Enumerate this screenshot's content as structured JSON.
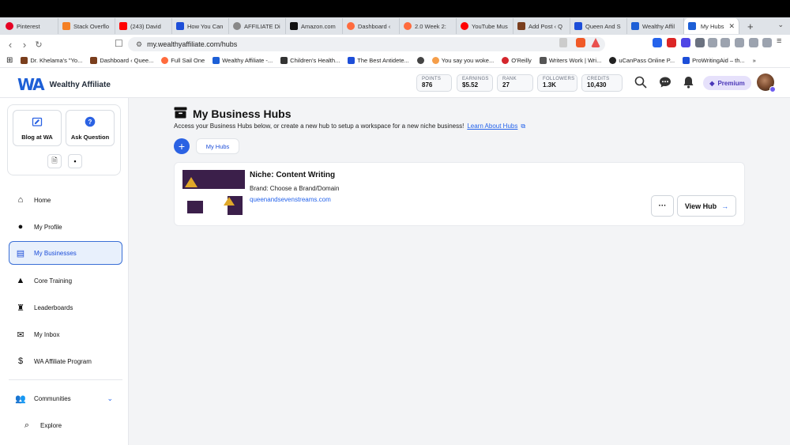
{
  "browser": {
    "tabs": [
      {
        "title": "Pinterest",
        "color": "#e60023"
      },
      {
        "title": "Stack Overflo",
        "color": "#f48024"
      },
      {
        "title": "(243) David",
        "color": "#ff0000"
      },
      {
        "title": "How You Can",
        "color": "#1d4ed8"
      },
      {
        "title": "AFFILIATE Di",
        "color": "#888888"
      },
      {
        "title": "Amazon.com",
        "color": "#111111"
      },
      {
        "title": "Dashboard ‹",
        "color": "#ff6b3d"
      },
      {
        "title": "2.0 Week 2:",
        "color": "#ff6b3d"
      },
      {
        "title": "YouTube Mus",
        "color": "#ff0000"
      },
      {
        "title": "Add Post ‹ Q",
        "color": "#7a3e1d"
      },
      {
        "title": "Queen And S",
        "color": "#1d4ed8"
      },
      {
        "title": "Wealthy Affil",
        "color": "#1d5fd6"
      }
    ],
    "active_tab": {
      "title": "My Hubs",
      "color": "#1d5fd6"
    },
    "url": "my.wealthyaffiliate.com/hubs",
    "bookmarks": [
      {
        "title": "Dr. Khelama's \"Yo...",
        "color": "#7a3e1d"
      },
      {
        "title": "Dashboard ‹ Quee...",
        "color": "#7a3e1d"
      },
      {
        "title": "Full Sail One",
        "color": "#ff6b3d"
      },
      {
        "title": "Wealthy Affiliate -...",
        "color": "#1d5fd6"
      },
      {
        "title": "Children's Health...",
        "color": "#333333"
      },
      {
        "title": "The Best Antidete...",
        "color": "#1d4ed8"
      },
      {
        "title": "",
        "color": "#444444"
      },
      {
        "title": "You say you woke...",
        "color": "#f59e4a"
      },
      {
        "title": "O'Reilly",
        "color": "#d4262c"
      },
      {
        "title": "Writers Work | Wri...",
        "color": "#555555"
      },
      {
        "title": "uCanPass Online P...",
        "color": "#222222"
      },
      {
        "title": "ProWritingAid – th...",
        "color": "#1d4ed8"
      }
    ]
  },
  "header": {
    "brand": "Wealthy Affiliate",
    "logo_mark": "WA",
    "stats": [
      {
        "label": "POINTS",
        "value": "876"
      },
      {
        "label": "EARNINGS",
        "value": "$5.52"
      },
      {
        "label": "RANK",
        "value": "27"
      },
      {
        "label": "FOLLOWERS",
        "value": "1.3K"
      },
      {
        "label": "CREDITS",
        "value": "10,430"
      }
    ],
    "premium_label": "Premium"
  },
  "sidebar": {
    "quick_actions": [
      {
        "label": "Blog at WA"
      },
      {
        "label": "Ask Question"
      }
    ],
    "items": [
      {
        "label": "Home",
        "icon": "home-icon"
      },
      {
        "label": "My Profile",
        "icon": "user-icon"
      },
      {
        "label": "My Businesses",
        "icon": "archive-icon"
      },
      {
        "label": "Core Training",
        "icon": "graduation-cap-icon"
      },
      {
        "label": "Leaderboards",
        "icon": "trophy-icon"
      },
      {
        "label": "My Inbox",
        "icon": "envelope-icon"
      },
      {
        "label": "WA Affiliate Program",
        "icon": "dollar-icon"
      }
    ],
    "bottom": [
      {
        "label": "Communities",
        "icon": "users-icon"
      },
      {
        "label": "Explore",
        "icon": "search-icon"
      }
    ]
  },
  "main": {
    "title": "My Business Hubs",
    "subtitle": "Access your Business Hubs below, or create a new hub to setup a workspace for a new niche business!",
    "learn_link": "Learn About Hubs",
    "tab_label": "My Hubs",
    "hub": {
      "niche": "Niche: Content Writing",
      "brand": "Brand: Choose a Brand/Domain",
      "domain": "queenandsevenstreams.com",
      "view_label": "View Hub",
      "more_label": "···"
    }
  }
}
